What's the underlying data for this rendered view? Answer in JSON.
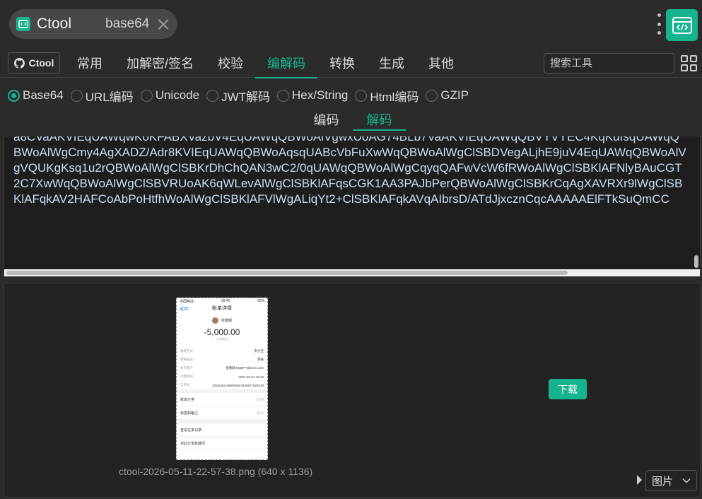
{
  "app": {
    "name": "Ctool",
    "tool": "base64"
  },
  "nav": {
    "github_label": "Ctool",
    "tabs": [
      {
        "label": "常用",
        "active": false
      },
      {
        "label": "加解密/签名",
        "active": false
      },
      {
        "label": "校验",
        "active": false
      },
      {
        "label": "编解码",
        "active": true
      },
      {
        "label": "转换",
        "active": false
      },
      {
        "label": "生成",
        "active": false
      },
      {
        "label": "其他",
        "active": false
      }
    ],
    "search_placeholder": "搜索工具"
  },
  "radios": [
    {
      "label": "Base64",
      "checked": true
    },
    {
      "label": "URL编码",
      "checked": false
    },
    {
      "label": "Unicode",
      "checked": false
    },
    {
      "label": "JWT解码",
      "checked": false
    },
    {
      "label": "Hex/String",
      "checked": false
    },
    {
      "label": "Html编码",
      "checked": false
    },
    {
      "label": "GZIP",
      "checked": false
    }
  ],
  "subtabs": [
    {
      "label": "编码",
      "active": false
    },
    {
      "label": "解码",
      "active": true
    }
  ],
  "input": {
    "text": "a8CVaAKVIEqUAWqwKoKFABXVazbV4EqUAWqQBWoAlVgwxUoAG74BLb7VaAKVIEqUAWqQBVYVYEC4KqKdfsqUAWqQBWoAlWgCmy4AgXADZ/Adr8KVIEqUAWqQBWoAqsqUABcVbFuXwWqQBWoAlWgClSBDVegALjhE9juV4EqUAWqQBWoAlVgVQUKgKsq1u2rQBWoAlWgClSBKrDhChQAN3wC2/0qUAWqQBWoAlWgCqyqQAFwVcW6fRWoAlWgClSBKlAFNlyBAuCGT2C7XwWqQBWoAlWgClSBVRUoAK6qWLevAlWgClSBKlAFqsCGK1AA3PAJbPerQBWoAlWgClSBKrCqAgXAVRXr9lWgClSBKlAFqkAV2HAFCoAbPoHtfhWoAlWgClSBKlAFVlWgALiqYt2+ClSBKlAFqkAVqAIbrsD/ATdJjxcznCqcAAAAAElFTkSuQmCC"
  },
  "preview": {
    "caption": "ctool-2026-05-11-22-57-38.png (640 x 1136)",
    "download_label": "下载",
    "type_label": "图片",
    "thumb": {
      "status_left": "中国移动",
      "status_time": "19:40",
      "status_right": "62%",
      "back_label": "返回",
      "title": "账单详情",
      "payee": "张德顺",
      "amount": "-5,000.00",
      "status": "交易成功",
      "rows": [
        {
          "k": "收款方式",
          "v": "支付宝"
        },
        {
          "k": "转账备注",
          "v": "转账"
        },
        {
          "k": "对方账户",
          "v": "张德顺 NQB***@21cn.com"
        },
        {
          "k": "创建时间",
          "v": "2024-03-21 19:42"
        },
        {
          "k": "订单号",
          "v": "20240321090000544336977826318"
        }
      ],
      "links": [
        {
          "label": "账单分类",
          "right": "其他"
        },
        {
          "label": "标签和备注",
          "right": "添加"
        },
        {
          "label": "查看往来记录",
          "right": ""
        },
        {
          "label": "对此订单有疑问",
          "right": ""
        }
      ]
    }
  },
  "colors": {
    "accent": "#16b48e",
    "background": "#2b2b2b",
    "panel": "#1e1e1e"
  }
}
